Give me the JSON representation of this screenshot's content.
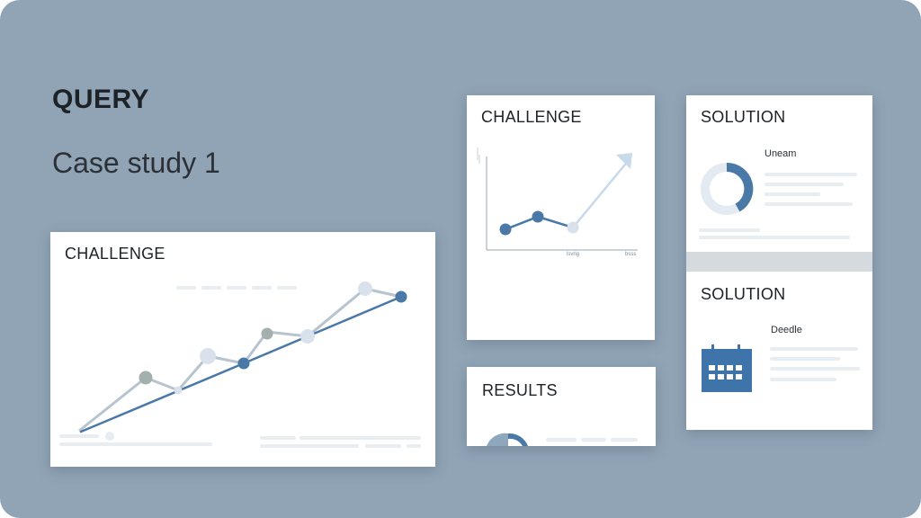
{
  "page": {
    "heading": "QUERY",
    "subheading": "Case study 1"
  },
  "cards": {
    "challenge_large": {
      "title": "CHALLENGE"
    },
    "challenge_small": {
      "title": "CHALLENGE",
      "tick_labels": [
        "lsvrig",
        "bsss"
      ]
    },
    "solution_top": {
      "title": "SOLUTION",
      "label": "Uneam"
    },
    "solution_bottom": {
      "title": "SOLUTION",
      "label": "Deedle"
    },
    "results": {
      "title": "RESULTS"
    }
  },
  "colors": {
    "background": "#90a4b6",
    "accent_blue": "#4a79a8",
    "line_gray": "#b7c3ce",
    "marker_gray": "#a3b0ad",
    "marker_light": "#d9e2ec",
    "divider": "#d5dadf"
  },
  "icons": {
    "calendar": "calendar-icon",
    "donut": "donut-chart-icon",
    "arrow": "trend-arrow-icon"
  }
}
